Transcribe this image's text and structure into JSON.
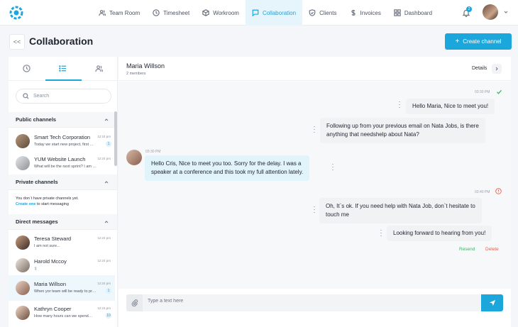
{
  "nav": {
    "items": [
      {
        "label": "Team Room",
        "icon": "users-icon"
      },
      {
        "label": "Timesheet",
        "icon": "clock-icon"
      },
      {
        "label": "Workroom",
        "icon": "cube-icon"
      },
      {
        "label": "Collaboration",
        "icon": "chat-icon",
        "active": true
      },
      {
        "label": "Clients",
        "icon": "shield-icon"
      },
      {
        "label": "Invoices",
        "icon": "dollar-icon"
      },
      {
        "label": "Dashboard",
        "icon": "grid-icon"
      }
    ],
    "notification_count": "2"
  },
  "header": {
    "back_label": "<<",
    "title": "Collaboration",
    "create_label": "Create channel"
  },
  "sidebar": {
    "search_placeholder": "Search",
    "public_title": "Public channels",
    "public_channels": [
      {
        "name": "Smart Tech Corporation",
        "message": "Today we start new project, first …",
        "time": "12:24 pm",
        "badge": "1"
      },
      {
        "name": "YUM Website Launch",
        "message": "What will be the next sprint? I am …",
        "time": "12:24 pm",
        "badge": ""
      }
    ],
    "private_title": "Private channels",
    "private_empty": "You don`t have private channels yet.",
    "private_link": "Create one",
    "private_suffix": "to start messaging",
    "direct_title": "Direct messages",
    "direct": [
      {
        "name": "Teresa Steward",
        "message": "I am not sure...",
        "time": "12:24 pm",
        "badge": ""
      },
      {
        "name": "Harold Mccoy",
        "message": ":)",
        "time": "12:24 pm",
        "badge": ""
      },
      {
        "name": "Maria Willson",
        "message": "When yor team will be ready to pr…",
        "time": "12:24 pm",
        "badge": "1"
      },
      {
        "name": "Kathryn Cooper",
        "message": "How many hours can we spend…",
        "time": "12:24 pm",
        "badge": "10"
      }
    ]
  },
  "chat": {
    "name": "Maria Willson",
    "members": "2 members",
    "details_label": "Details",
    "messages": {
      "t1": "03:30 PM",
      "m1": "Hello Maria, Nice to meet you!",
      "m2a": "Following up from your previous email on Nata Jobs, is there",
      "m2b": "anything that needshelp about Nata?",
      "t2": "03:30 PM",
      "m3a": "Hello Cris, Nice to meet you too. Sorry for the delay. I was a",
      "m3b": "speaker at a conference and this took my full attention lately.",
      "t3": "03:40 PM",
      "m4a": "Oh, It`s ok. If you need help with Nata Job, don`t hesitate to",
      "m4b": "touch me",
      "m5": "Looking forward to hearing from you!",
      "resend": "Resend",
      "delete": "Delete"
    },
    "composer_placeholder": "Type a text here"
  },
  "colors": {
    "accent": "#1ba6dc",
    "success": "#3fb26b",
    "danger": "#e5604d"
  }
}
